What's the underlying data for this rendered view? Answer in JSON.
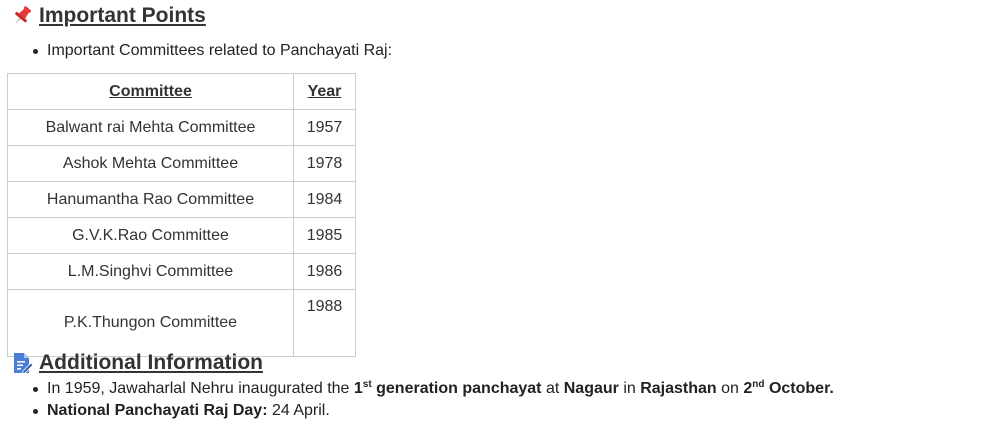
{
  "important_points": {
    "title": "Important Points",
    "icon": "pushpin-icon",
    "bullet": "Important Committees related to Panchayati Raj:"
  },
  "table": {
    "headers": [
      "Committee",
      "Year"
    ],
    "rows": [
      {
        "committee": "Balwant rai Mehta Committee",
        "year": "1957"
      },
      {
        "committee": "Ashok Mehta Committee",
        "year": "1978"
      },
      {
        "committee": "Hanumantha Rao Committee",
        "year": "1984"
      },
      {
        "committee": "G.V.K.Rao Committee",
        "year": "1985"
      },
      {
        "committee": "L.M.Singhvi Committee",
        "year": "1986"
      },
      {
        "committee": "P.K.Thungon Committee",
        "year": "1988"
      }
    ]
  },
  "additional_information": {
    "title": "Additional Information",
    "icon": "document-edit-icon",
    "bullet1": {
      "prefix": "In 1959, Jawaharlal Nehru inaugurated the ",
      "ordinal_num": "1",
      "ordinal_sup": "st",
      "phrase": " generation panchayat",
      "at": " at ",
      "place": "Nagaur",
      "in": " in ",
      "state": "Rajasthan",
      "on": " on ",
      "date_num": "2",
      "date_sup": "nd",
      "date_month": " October."
    },
    "bullet2": {
      "label": "National Panchayati Raj Day:",
      "value": " 24 April."
    }
  },
  "colors": {
    "pin": "#e53935",
    "doc_icon": "#4a7fd6",
    "border": "#cccccc"
  }
}
